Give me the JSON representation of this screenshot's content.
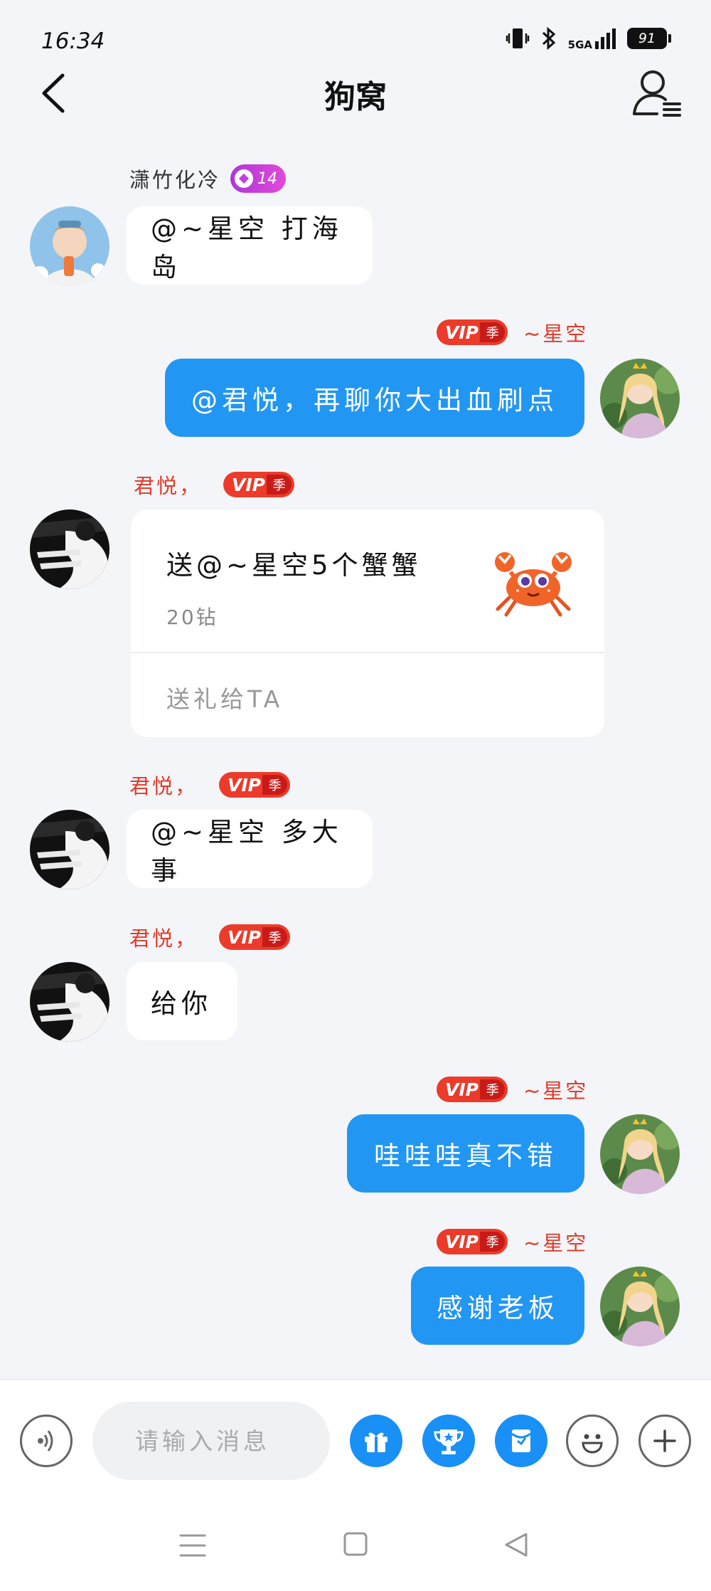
{
  "status_bar": {
    "time": "16:34",
    "signal": "5GA",
    "battery": "91"
  },
  "header": {
    "title": "狗窝"
  },
  "colors": {
    "accent_blue": "#2296f3",
    "vip_red": "#ec3b2a",
    "background": "#f4f5f8"
  },
  "messages": [
    {
      "side": "left",
      "sender": "潇竹化冷",
      "level": "14",
      "text": "@~星空 打海岛"
    },
    {
      "side": "right",
      "sender": "~星空",
      "vip": "VIP",
      "vip_season": "季",
      "text": "@君悦，再聊你大出血刷点"
    },
    {
      "side": "left",
      "sender": "君悦，",
      "vip": "VIP",
      "vip_season": "季",
      "gift": {
        "title": "送@~星空5个蟹蟹",
        "price": "20钻",
        "action": "送礼给TA",
        "icon": "crab-icon"
      }
    },
    {
      "side": "left",
      "sender": "君悦，",
      "vip": "VIP",
      "vip_season": "季",
      "text": "@~星空 多大事"
    },
    {
      "side": "left",
      "sender": "君悦，",
      "vip": "VIP",
      "vip_season": "季",
      "text": "给你"
    },
    {
      "side": "right",
      "sender": "~星空",
      "vip": "VIP",
      "vip_season": "季",
      "text": "哇哇哇真不错"
    },
    {
      "side": "right",
      "sender": "~星空",
      "vip": "VIP",
      "vip_season": "季",
      "text": "感谢老板"
    }
  ],
  "composer": {
    "placeholder": "请输入消息",
    "icons": [
      "voice-icon",
      "gift-icon",
      "trophy-icon",
      "red-packet-icon",
      "emoji-icon",
      "plus-icon"
    ]
  },
  "nav_bar": {
    "icons": [
      "menu-icon",
      "home-icon",
      "back-triangle-icon"
    ]
  }
}
